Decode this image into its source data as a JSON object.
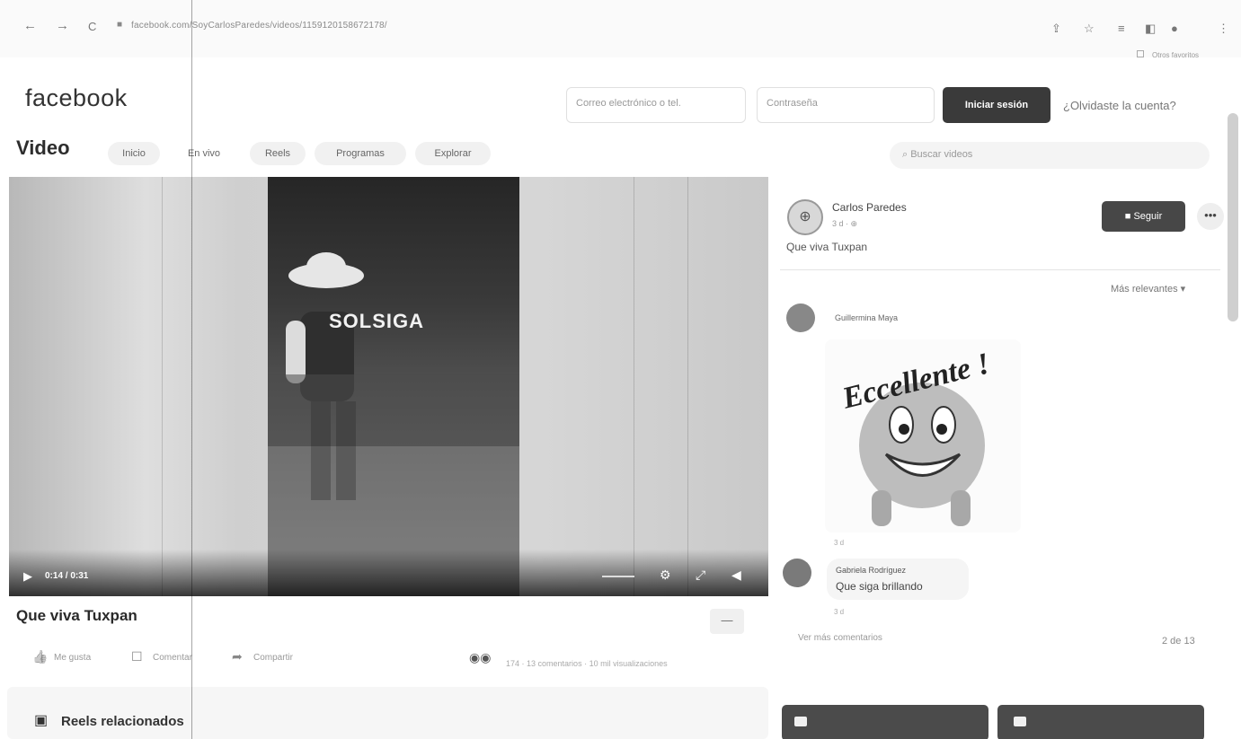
{
  "browser": {
    "back": "←",
    "forward": "→",
    "reload": "C",
    "url": "facebook.com/SoyCarlosParedes/videos/1159120158672178/",
    "bookmarks_label": "Otros favoritos"
  },
  "header": {
    "logo": "facebook",
    "email_placeholder": "Correo electrónico o tel.",
    "password_placeholder": "Contraseña",
    "login_label": "Iniciar sesión",
    "forgot_label": "¿Olvidaste la cuenta?"
  },
  "video_nav": {
    "title": "Video",
    "tabs": [
      "Inicio",
      "En vivo",
      "Reels",
      "Programas",
      "Explorar"
    ],
    "search_placeholder": "Buscar videos"
  },
  "video": {
    "overlay_text": "SOLSIGA",
    "time": "0:14 / 0:31",
    "post_title": "Que viva Tuxpan"
  },
  "actions": {
    "like": "Me gusta",
    "comment": "Comentar",
    "share": "Compartir",
    "reactions": "174",
    "comments_count": "13 comentarios",
    "views": "10 mil visualizaciones"
  },
  "reels": {
    "title": "Reels relacionados"
  },
  "post": {
    "author": "Carlos Paredes",
    "meta": "3 d · ⊕",
    "text": "Que viva Tuxpan",
    "follow_label": "Seguir",
    "more_label": "•••",
    "sort_label": "Más relevantes ▾"
  },
  "comments": [
    {
      "author": "Guillermina Maya",
      "sticker_text": "Eccellente !",
      "time": "3 d"
    },
    {
      "author": "Gabriela Rodríguez",
      "text": "Que siga brillando",
      "time": "3 d"
    }
  ],
  "comments_footer": {
    "more": "Ver más comentarios",
    "count": "2 de 13"
  }
}
